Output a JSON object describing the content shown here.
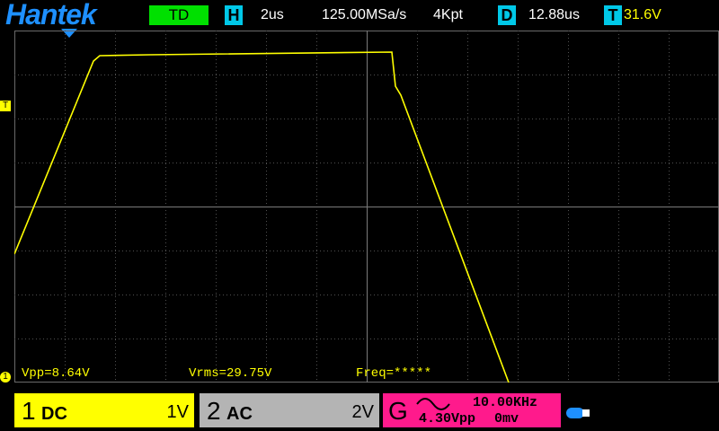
{
  "header": {
    "brand": "Hantek",
    "trigger_mode": "TD",
    "h_badge": "H",
    "timebase": "2us",
    "sample_rate": "125.00MSa/s",
    "memory_depth": "4Kpt",
    "d_badge": "D",
    "delay": "12.88us",
    "t_badge": "T",
    "trigger_level": "31.6V"
  },
  "markers": {
    "trigger": "T",
    "ground": "1"
  },
  "measurements": {
    "vpp": "Vpp=8.64V",
    "vrms": "Vrms=29.75V",
    "freq": "Freq=*****"
  },
  "channels": {
    "ch1": {
      "number": "1",
      "coupling": "DC",
      "scale": "1V"
    },
    "ch2": {
      "number": "2",
      "coupling": "AC",
      "scale": "2V"
    }
  },
  "generator": {
    "label": "G",
    "frequency": "10.00KHz",
    "amplitude": "4.30Vpp",
    "offset": "0mv"
  },
  "colors": {
    "trace": "#ffff00",
    "ch1": "#ffff00",
    "ch2": "#b4b4b4",
    "generator": "#ff1a8c",
    "brand": "#1e90ff",
    "badge": "#00c8e8",
    "td": "#00e000"
  },
  "icons": {
    "trigger_position": "down-triangle-icon",
    "waveform": "sine-wave-icon",
    "usb": "usb-icon"
  }
}
